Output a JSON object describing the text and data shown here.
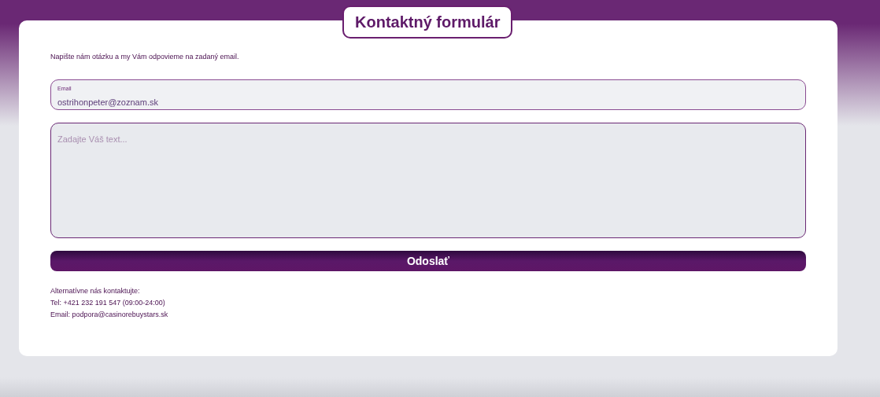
{
  "title": "Kontaktný formulár",
  "intro": "Napište nám otázku a my Vám odpovieme na zadaný email.",
  "email_field": {
    "label": "Email",
    "value": "ostrihonpeter@zoznam.sk"
  },
  "message_field": {
    "placeholder": "Zadajte Váš text..."
  },
  "submit_button": "Odoslať",
  "contact_lines": [
    "Alternatívne nás kontaktujte:",
    "Tel: +421 232 191 547 (09:00-24:00)",
    "Email: podpora@casinorebuystars.sk"
  ]
}
